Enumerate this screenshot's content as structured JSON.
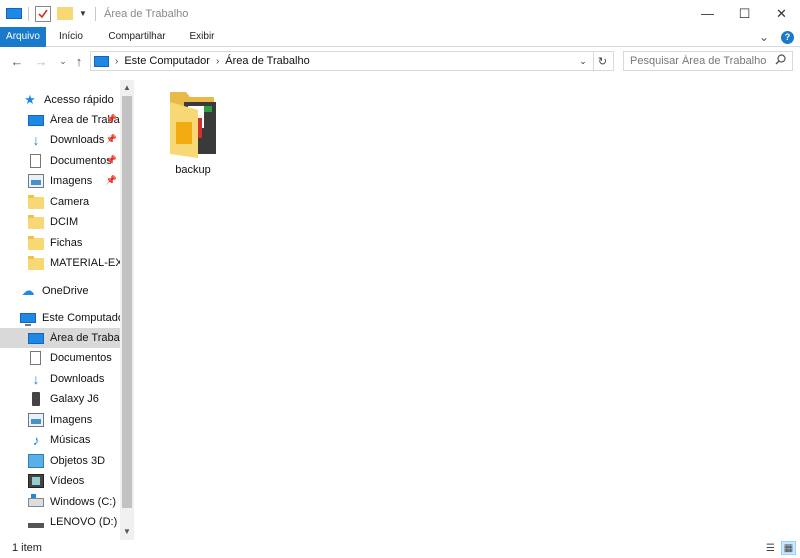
{
  "window": {
    "title": "Área de Trabalho",
    "minimize": "—",
    "maximize": "☐",
    "close": "✕"
  },
  "ribbon": {
    "tabs": [
      {
        "label": "Arquivo"
      },
      {
        "label": "Início"
      },
      {
        "label": "Compartilhar"
      },
      {
        "label": "Exibir"
      }
    ],
    "expand_glyph": "⌄",
    "help_glyph": "?"
  },
  "addressbar": {
    "back": "←",
    "forward": "→",
    "recent": "⌄",
    "up": "↑",
    "crumbs": [
      "Este Computador",
      "Área de Trabalho"
    ],
    "crumb_sep": "›",
    "dropdown": "⌄",
    "refresh": "↻"
  },
  "search": {
    "placeholder": "Pesquisar Área de Trabalho",
    "icon": "search-icon"
  },
  "navpane": {
    "quick_access": {
      "label": "Acesso rápido",
      "icon": "star-icon"
    },
    "quick_items": [
      {
        "label": "Área de Traba",
        "icon": "desktop-icon",
        "pinned": true
      },
      {
        "label": "Downloads",
        "icon": "downloads-icon",
        "pinned": true
      },
      {
        "label": "Documentos",
        "icon": "documents-icon",
        "pinned": true
      },
      {
        "label": "Imagens",
        "icon": "pictures-icon",
        "pinned": true
      },
      {
        "label": "Camera",
        "icon": "folder-icon"
      },
      {
        "label": "DCIM",
        "icon": "folder-icon"
      },
      {
        "label": "Fichas",
        "icon": "folder-icon"
      },
      {
        "label": "MATERIAL-EXTE",
        "icon": "folder-icon"
      }
    ],
    "onedrive": {
      "label": "OneDrive",
      "icon": "cloud-icon"
    },
    "this_pc": {
      "label": "Este Computador",
      "icon": "computer-icon"
    },
    "pc_items": [
      {
        "label": "Área de Trabalho",
        "icon": "desktop-icon",
        "selected": true
      },
      {
        "label": "Documentos",
        "icon": "documents-icon"
      },
      {
        "label": "Downloads",
        "icon": "downloads-icon"
      },
      {
        "label": "Galaxy J6",
        "icon": "phone-icon"
      },
      {
        "label": "Imagens",
        "icon": "pictures-icon"
      },
      {
        "label": "Músicas",
        "icon": "music-icon"
      },
      {
        "label": "Objetos 3D",
        "icon": "objects-3d-icon"
      },
      {
        "label": "Vídeos",
        "icon": "videos-icon"
      },
      {
        "label": "Windows (C:)",
        "icon": "drive-icon"
      },
      {
        "label": "LENOVO (D:)",
        "icon": "drive-icon"
      }
    ],
    "scroll_up": "▲",
    "scroll_down": "▼"
  },
  "content": {
    "items": [
      {
        "label": "backup",
        "icon": "folder-icon"
      }
    ]
  },
  "status": {
    "text": "1 item"
  },
  "colors": {
    "accent": "#1979ca",
    "selection": "#cce8ff",
    "folder": "#f8d775"
  }
}
